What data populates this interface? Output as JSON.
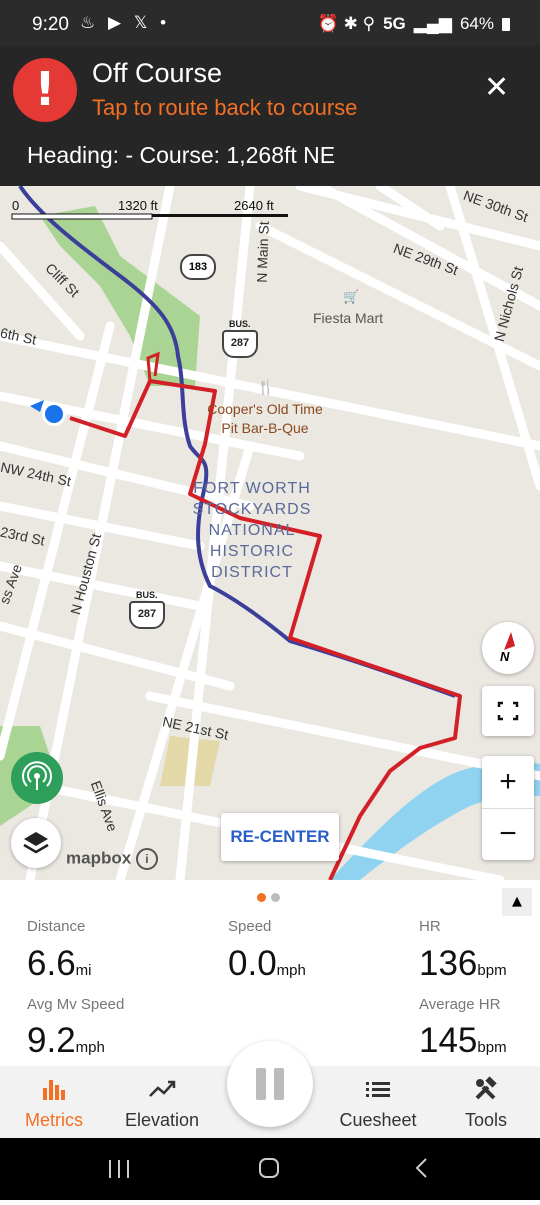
{
  "status_bar": {
    "time": "9:20",
    "left_icons": "♨ ▶ 𝕏 •",
    "right_icons": "⏰ ✱ ⚲",
    "network": "5G",
    "signal": "▂▄▆",
    "battery": "64%"
  },
  "alert": {
    "icon": "warning-icon",
    "title": "Off Course",
    "subtitle": "Tap to route back to course",
    "close_glyph": "✕",
    "heading_info": "Heading: - Course: 1,268ft NE"
  },
  "map": {
    "scale": [
      "0",
      "1320 ft",
      "2640 ft"
    ],
    "streets": [
      "NE 30th St",
      "NE 29th St",
      "Cliff St",
      "N Main St",
      "N Nichols St",
      "6th St",
      "NW 24th St",
      "23rd St",
      "N Houston St",
      "ss Ave",
      "NE 21st St",
      "Ellis Ave"
    ],
    "shields": {
      "route_183": "183",
      "bus_label": "BUS.",
      "bus_287": "287"
    },
    "pois": {
      "fiesta": "Fiesta Mart",
      "coopers_line1": "Cooper's Old Time",
      "coopers_line2": "Pit Bar-B-Que"
    },
    "district": [
      "FORT WORTH",
      "STOCKYARDS",
      "NATIONAL",
      "HISTORIC",
      "DISTRICT"
    ],
    "compass": "N",
    "zoom_in": "+",
    "zoom_out": "−",
    "recenter": "RE-CENTER",
    "attribution": "mapbox",
    "colors": {
      "route_red": "#d32027",
      "track_blue": "#3b3f9a",
      "water": "#8fd3f0",
      "park": "#aad494"
    }
  },
  "metrics": {
    "page_dots": 2,
    "items": [
      {
        "label": "Distance",
        "value": "6.6",
        "unit": "mi"
      },
      {
        "label": "Speed",
        "value": "0.0",
        "unit": "mph"
      },
      {
        "label": "HR",
        "value": "136",
        "unit": "bpm"
      },
      {
        "label": "Avg Mv Speed",
        "value": "9.2",
        "unit": "mph"
      },
      {
        "label": "Average HR",
        "value": "145",
        "unit": "bpm"
      }
    ],
    "expand_glyph": "▲"
  },
  "tabs": [
    {
      "label": "Metrics",
      "icon": "bar-chart-icon",
      "active": true
    },
    {
      "label": "Elevation",
      "icon": "trend-icon"
    },
    {
      "label": "Cuesheet",
      "icon": "list-icon"
    },
    {
      "label": "Tools",
      "icon": "tools-icon"
    }
  ],
  "accent_color": "#f36f21"
}
